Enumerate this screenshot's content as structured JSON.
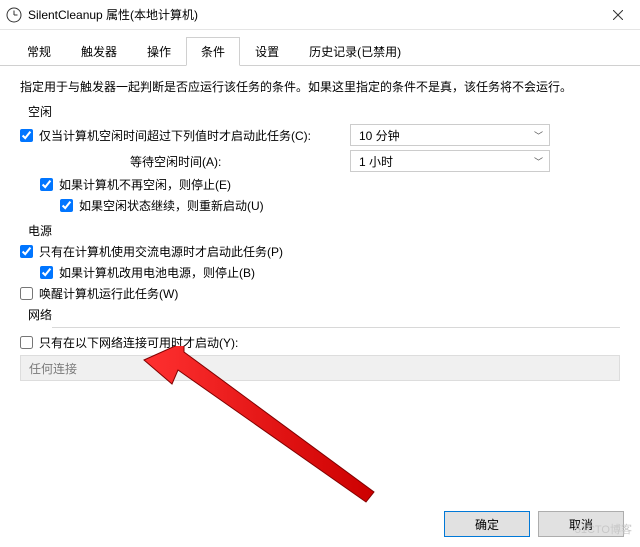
{
  "title": "SilentCleanup 属性(本地计算机)",
  "tabs": {
    "general": "常规",
    "triggers": "触发器",
    "actions": "操作",
    "conditions": "条件",
    "settings": "设置",
    "history": "历史记录(已禁用)"
  },
  "desc": "指定用于与触发器一起判断是否应运行该任务的条件。如果这里指定的条件不是真，该任务将不会运行。",
  "groups": {
    "idle": "空闲",
    "power": "电源",
    "network": "网络"
  },
  "options": {
    "idle_start": "仅当计算机空闲时间超过下列值时才启动此任务(C):",
    "idle_wait_label": "等待空闲时间(A):",
    "idle_stop": "如果计算机不再空闲，则停止(E)",
    "idle_restart": "如果空闲状态继续，则重新启动(U)",
    "power_ac": "只有在计算机使用交流电源时才启动此任务(P)",
    "power_battery_stop": "如果计算机改用电池电源，则停止(B)",
    "wake": "唤醒计算机运行此任务(W)",
    "network": "只有在以下网络连接可用时才启动(Y):"
  },
  "selects": {
    "idle_minutes": "10 分钟",
    "idle_wait": "1 小时",
    "network_conn": "任何连接"
  },
  "buttons": {
    "ok": "确定",
    "cancel": "取消"
  },
  "watermark": "51CTO博客"
}
